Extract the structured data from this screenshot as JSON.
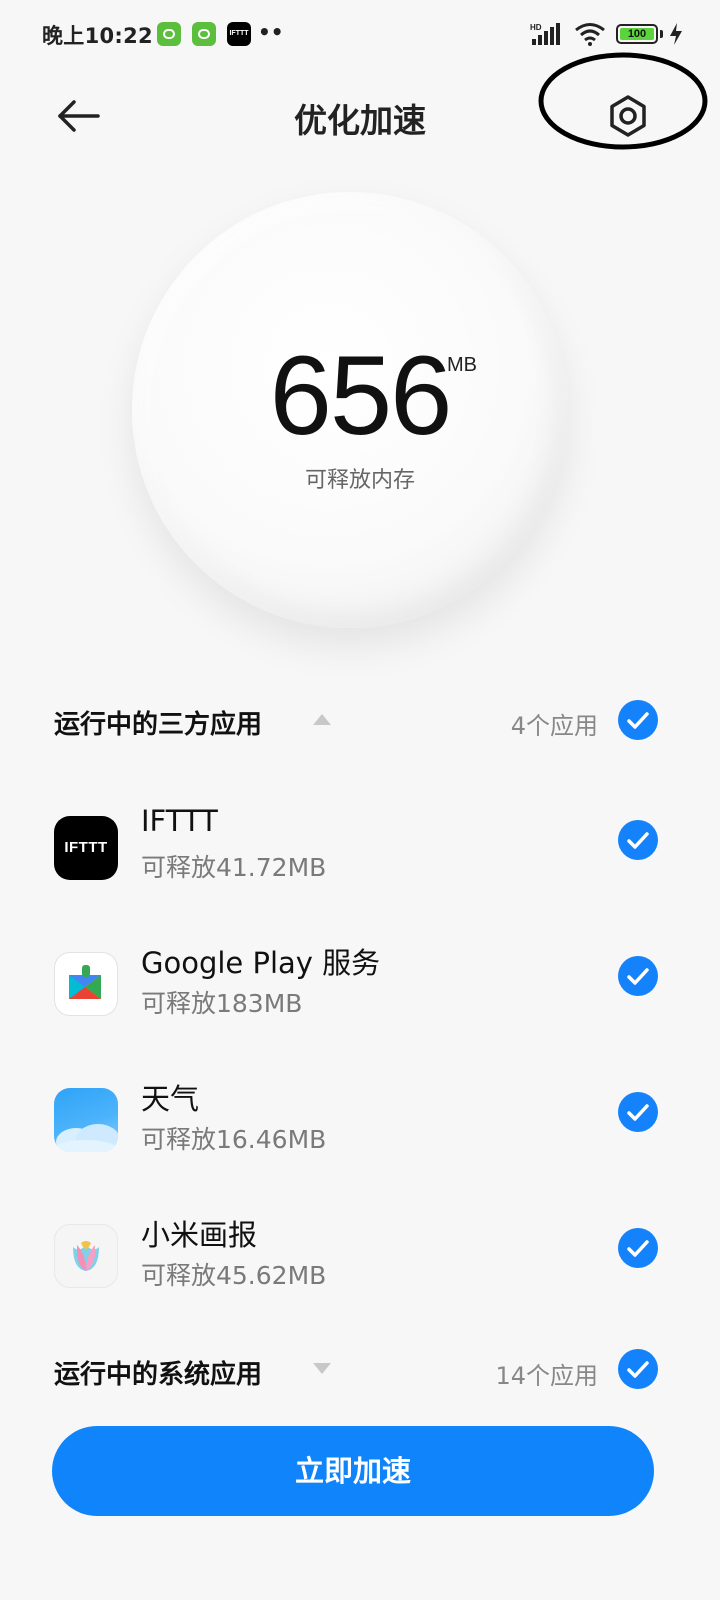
{
  "status_bar": {
    "time": "晚上10:22",
    "notification_icons": [
      "app-green-icon",
      "app-green-icon",
      "ifttt-icon"
    ],
    "ifttt_badge_text": "IFTTT",
    "more_dots": "••",
    "signal_label": "HD",
    "battery_level": "100",
    "battery_color": "#5bd33a",
    "charging": true
  },
  "header": {
    "title": "优化加速",
    "back_icon": "arrow-left-icon",
    "settings_icon": "settings-hexagon-icon"
  },
  "memory": {
    "value": "656",
    "unit": "MB",
    "label": "可释放内存"
  },
  "third_party_section": {
    "title": "运行中的三方应用",
    "count_label": "4个应用",
    "expanded": true,
    "checked": true,
    "apps": [
      {
        "name": "IFTTT",
        "releasable": "可释放41.72MB",
        "icon": "ifttt-icon",
        "icon_text": "IFTTT",
        "checked": true
      },
      {
        "name": "Google Play 服务",
        "releasable": "可释放183MB",
        "icon": "google-play-services-icon",
        "checked": true
      },
      {
        "name": "天气",
        "releasable": "可释放16.46MB",
        "icon": "weather-icon",
        "checked": true
      },
      {
        "name": "小米画报",
        "releasable": "可释放45.62MB",
        "icon": "mi-wallpaper-carousel-icon",
        "checked": true
      }
    ]
  },
  "system_section": {
    "title": "运行中的系统应用",
    "count_label": "14个应用",
    "expanded": false,
    "checked": true
  },
  "action": {
    "boost_label": "立即加速",
    "accent_color": "#0f84fb"
  }
}
